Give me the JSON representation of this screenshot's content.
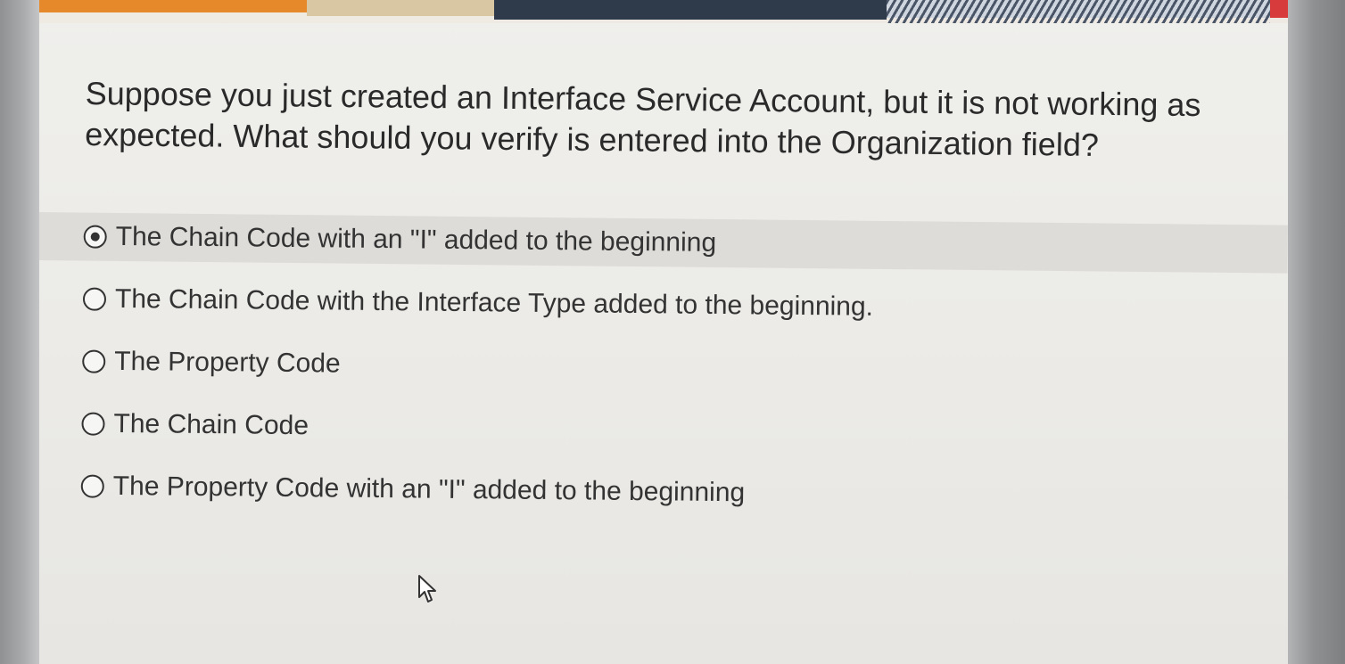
{
  "question": {
    "text": "Suppose you just created an Interface Service Account, but it is not working as expected. What should you verify is entered into the Organization field?"
  },
  "options": [
    {
      "label": "The Chain Code with an \"I\" added to the beginning",
      "selected": true
    },
    {
      "label": "The Chain Code with the Interface Type added to the beginning.",
      "selected": false
    },
    {
      "label": "The Property Code",
      "selected": false
    },
    {
      "label": "The Chain Code",
      "selected": false
    },
    {
      "label": "The Property Code with an \"I\" added to the beginning",
      "selected": false
    }
  ],
  "icons": {
    "cursor": "mouse-pointer-icon"
  },
  "colors": {
    "banner_orange": "#e6892a",
    "banner_navy": "#2f3b4a",
    "banner_red": "#d83b3b",
    "selected_row": "#dedcd8",
    "text": "#2a2a2a"
  }
}
